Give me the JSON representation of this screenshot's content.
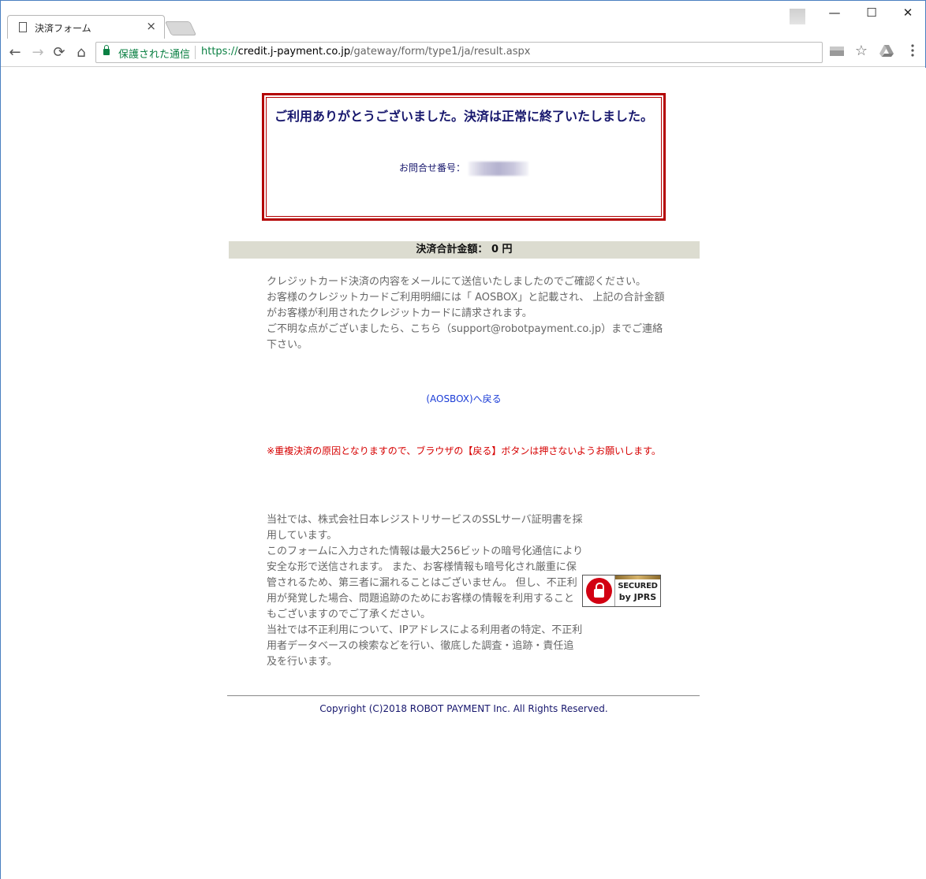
{
  "browser": {
    "tab_title": "決済フォーム",
    "tab_close": "×",
    "window_minimize": "—",
    "window_maximize": "☐",
    "window_close": "✕",
    "nav": {
      "back": "←",
      "forward": "→",
      "reload": "⟳",
      "home": "⌂"
    },
    "secure_label": "保護された通信",
    "url_scheme": "https://",
    "url_host": "credit.j-payment.co.jp",
    "url_path": "/gateway/form/type1/ja/result.aspx",
    "star": "☆"
  },
  "result": {
    "title": "ご利用ありがとうございました。決済は正常に終了いたしました。",
    "inquiry_label": "お問合せ番号："
  },
  "total": {
    "label": "決済合計金額：",
    "amount": "0",
    "unit": "円"
  },
  "notice": {
    "line1": "クレジットカード決済の内容をメールにて送信いたしましたのでご確認ください。",
    "line2": "お客様のクレジットカードご利用明細には「 AOSBOX」と記載され、 上記の合計金額がお客様が利用されたクレジットカードに請求されます。",
    "line3": "ご不明な点がございましたら、こちら（support@robotpayment.co.jp）までご連絡下さい。"
  },
  "back_link": "(AOSBOX)へ戻る",
  "warning": "※重複決済の原因となりますので、ブラウザの【戻る】ボタンは押さないようお願いします。",
  "ssl": {
    "p1": "当社では、株式会社日本レジストリサービスのSSLサーバ証明書を採用しています。",
    "p2": "このフォームに入力された情報は最大256ビットの暗号化通信により安全な形で送信されます。 また、お客様情報も暗号化され厳重に保管されるため、第三者に漏れることはございません。 但し、不正利用が発覚した場合、問題追跡のためにお客様の情報を利用することもございますのでご了承ください。",
    "p3": "当社では不正利用について、IPアドレスによる利用者の特定、不正利用者データベースの検索などを行い、徹底した調査・追跡・責任追及を行います。",
    "badge_line1": "SECURED",
    "badge_line2": "by JPRS"
  },
  "footer": {
    "copyright": "Copyright (C)2018 ROBOT PAYMENT Inc. All Rights Reserved."
  },
  "colors": {
    "title_navy": "#17176d",
    "frame_red": "#b30000",
    "warning_red": "#d60000",
    "link_blue": "#1a3cd7",
    "total_bar_bg": "#dcdcd0",
    "secure_green": "#0b8043"
  }
}
